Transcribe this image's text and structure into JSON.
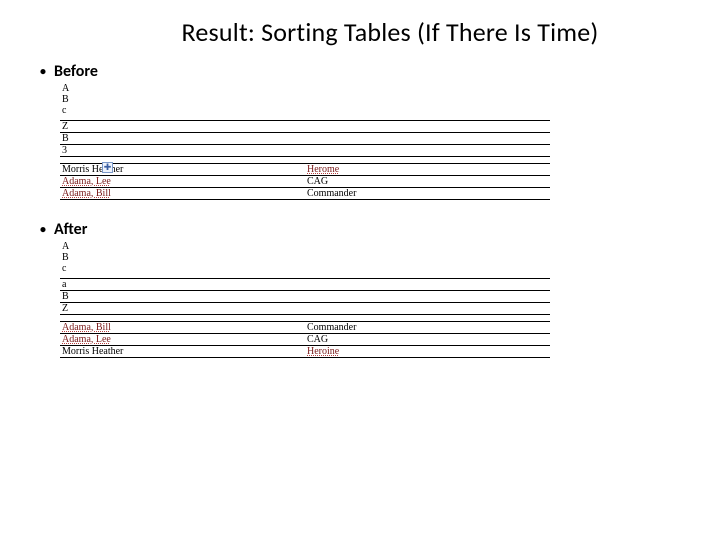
{
  "title": "Result: Sorting Tables (If There Is Time)",
  "before": {
    "label": "Before",
    "list1": [
      "A",
      "B",
      "c"
    ],
    "table1": [
      [
        "Z",
        ""
      ],
      [
        "B",
        ""
      ],
      [
        "3",
        ""
      ]
    ],
    "table2": [
      [
        "Morris Heather",
        "Herome"
      ],
      [
        "Adama, Lee",
        "CAG"
      ],
      [
        "Adama, Bill",
        "Commander"
      ]
    ]
  },
  "after": {
    "label": "After",
    "list1": [
      "A",
      "B",
      "c"
    ],
    "table1": [
      [
        "a",
        ""
      ],
      [
        "B",
        ""
      ],
      [
        "Z",
        ""
      ]
    ],
    "table2": [
      [
        "Adama, Bill",
        "Commander"
      ],
      [
        "Adama, Lee",
        "CAG"
      ],
      [
        "Morris Heather",
        "Heroine"
      ]
    ]
  },
  "handle_glyph": "✚"
}
